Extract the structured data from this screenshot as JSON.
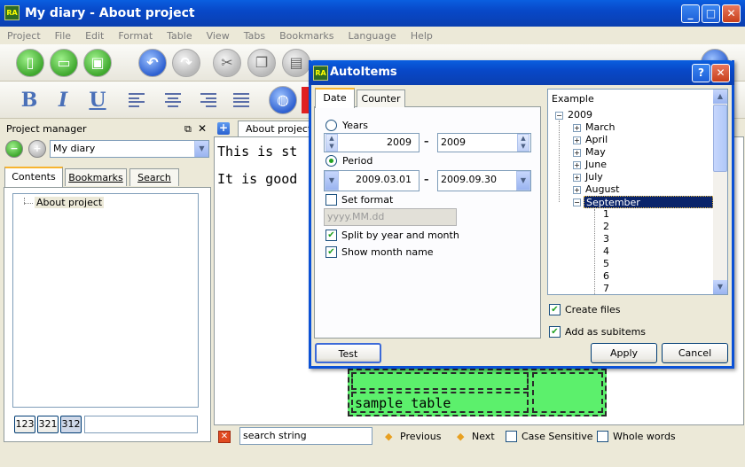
{
  "window": {
    "title": "My diary - About project",
    "icon_text": "RA"
  },
  "menu": [
    "Project",
    "File",
    "Edit",
    "Format",
    "Table",
    "View",
    "Tabs",
    "Bookmarks",
    "Language",
    "Help"
  ],
  "format_buttons": {
    "bold": "B",
    "italic": "I",
    "underline": "U"
  },
  "project_manager": {
    "title": "Project manager",
    "project_select": "My diary",
    "tabs": [
      "Contents",
      "Bookmarks",
      "Search"
    ],
    "tree_items": [
      "About project"
    ],
    "sort_buttons": [
      "123",
      "321",
      "312"
    ]
  },
  "editor": {
    "tab_label": "About project",
    "lines": [
      "This is st",
      "It is good"
    ],
    "table_text": "sample table"
  },
  "search_bar": {
    "value": "search string",
    "previous_label": "Previous",
    "next_label": "Next",
    "case_sensitive_label": "Case Sensitive",
    "whole_words_label": "Whole words"
  },
  "dialog": {
    "title": "AutoItems",
    "icon_text": "RA",
    "tabs": [
      "Date",
      "Counter"
    ],
    "years_label": "Years",
    "year_from": "2009",
    "year_to": "2009",
    "period_label": "Period",
    "period_from": "2009.03.01",
    "period_to": "2009.09.30",
    "dash": "–",
    "set_format_label": "Set format",
    "format_placeholder": "yyyy.MM.dd",
    "split_label": "Split by year and month",
    "show_month_label": "Show month name",
    "example_label": "Example",
    "tree": {
      "year": "2009",
      "months": [
        "March",
        "April",
        "May",
        "June",
        "July",
        "August",
        "September"
      ],
      "days": [
        "1",
        "2",
        "3",
        "4",
        "5",
        "6",
        "7"
      ]
    },
    "create_files_label": "Create files",
    "subitems_label": "Add as subitems",
    "test_label": "Test",
    "apply_label": "Apply",
    "cancel_label": "Cancel",
    "help_glyph": "?",
    "close_glyph": "✕"
  },
  "colors": {
    "title_bar": "#0848c8",
    "selection": "#0a246a",
    "table_fill": "#5cf06c"
  }
}
